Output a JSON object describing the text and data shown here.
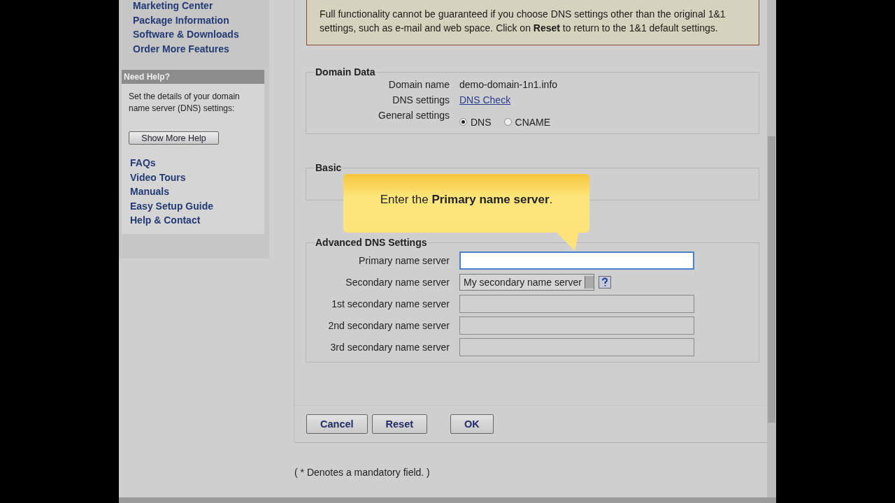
{
  "sidebar": {
    "links": [
      "Marketing Center",
      "Package Information",
      "Software & Downloads",
      "Order More Features"
    ],
    "help": {
      "title": "Need Help?",
      "text": "Set the details of your domain name server (DNS) settings:",
      "button": "Show More Help",
      "links": [
        "FAQs",
        "Video Tours",
        "Manuals",
        "Easy Setup Guide",
        "Help & Contact"
      ]
    }
  },
  "warning": "Full functionality cannot be guaranteed if you choose DNS settings other than the original 1&1 settings, such as e-mail and web space. Click on **Reset** to return to the 1&1 default settings.",
  "domain_data": {
    "title": "Domain Data",
    "rows": [
      {
        "label": "Domain name",
        "kind": "text",
        "value": "demo-domain-1n1.info"
      },
      {
        "label": "DNS settings",
        "kind": "link",
        "value": "DNS Check"
      },
      {
        "label": "General settings",
        "kind": "radios",
        "options": [
          {
            "label": "DNS",
            "selected": true
          },
          {
            "label": "CNAME",
            "selected": false
          }
        ]
      }
    ]
  },
  "basic_dns": {
    "title": "Basic"
  },
  "tooltip": "Enter the **Primary name server**.",
  "advanced_dns": {
    "title": "Advanced DNS Settings",
    "fields": [
      {
        "label": "Primary name server",
        "kind": "input",
        "focused": true
      },
      {
        "label": "Secondary name server",
        "kind": "select",
        "value": "My secondary name server"
      },
      {
        "label": "1st secondary name server",
        "kind": "input",
        "disabled": true
      },
      {
        "label": "2nd secondary name server",
        "kind": "input",
        "disabled": true
      },
      {
        "label": "3rd secondary name server",
        "kind": "input",
        "disabled": true
      }
    ]
  },
  "buttons": [
    "Cancel",
    "Reset",
    "OK"
  ],
  "footnote": "( * Denotes a mandatory field. )"
}
